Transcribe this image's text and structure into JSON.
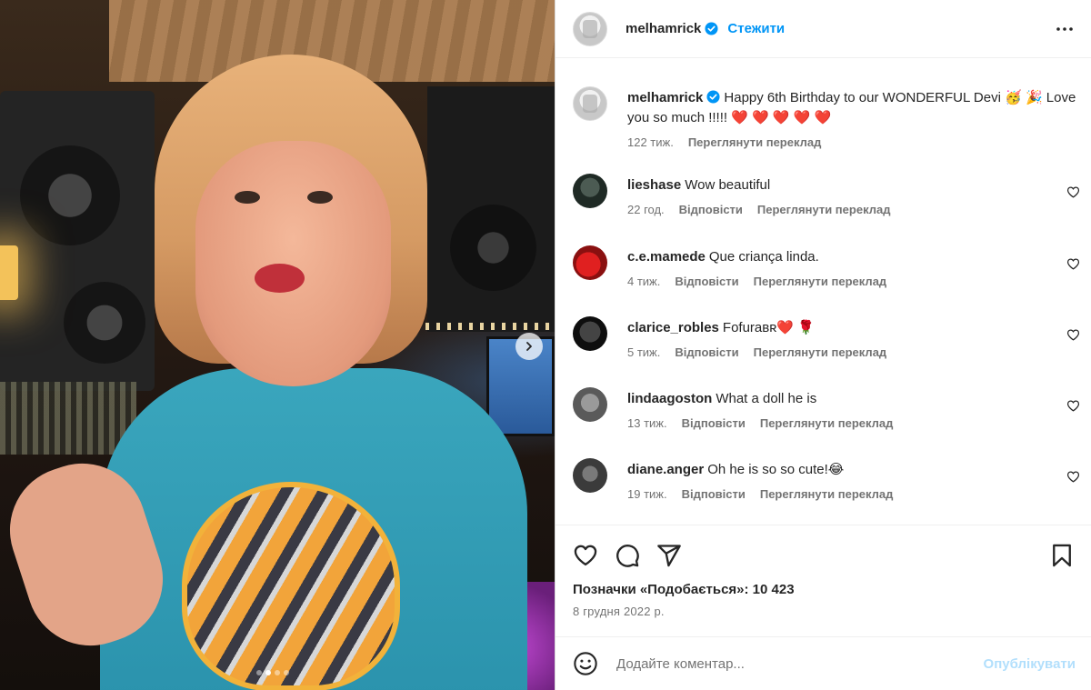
{
  "post": {
    "owner": "melhamrick",
    "follow_label": "Стежити",
    "caption": "Happy 6th Birthday to our WONDERFUL Devi 🥳 🎉 Love you so much !!!!! ❤️ ❤️ ❤️ ❤️ ❤️",
    "caption_time": "122 тиж.",
    "see_translation": "Переглянути переклад",
    "likes_label": "Позначки «Подобається»: 10 423",
    "date": "8 грудня 2022 р.",
    "carousel": {
      "current_slide": 2,
      "total_slides": 4
    }
  },
  "comments": [
    {
      "user": "lieshase",
      "text": "Wow beautiful",
      "time": "22 год.",
      "reply": "Відповісти",
      "translate": "Переглянути переклад"
    },
    {
      "user": "c.e.mamede",
      "text": "Que criança linda.",
      "time": "4 тиж.",
      "reply": "Відповісти",
      "translate": "Переглянути переклад"
    },
    {
      "user": "clarice_robles",
      "text": "Fofuraʙʀ❤️ 🌹",
      "time": "5 тиж.",
      "reply": "Відповісти",
      "translate": "Переглянути переклад"
    },
    {
      "user": "lindaagoston",
      "text": "What a doll he is",
      "time": "13 тиж.",
      "reply": "Відповісти",
      "translate": "Переглянути переклад"
    },
    {
      "user": "diane.anger",
      "text": "Oh he is so so cute!😂",
      "time": "19 тиж.",
      "reply": "Відповісти",
      "translate": "Переглянути переклад"
    }
  ],
  "composer": {
    "placeholder": "Додайте коментар...",
    "publish_label": "Опублікувати"
  },
  "icons": {
    "verified": "verified-badge-icon",
    "more": "more-options-icon",
    "like": "heart-icon",
    "comment": "comment-icon",
    "share": "share-icon",
    "save": "bookmark-icon",
    "emoji": "emoji-icon",
    "next": "chevron-right-icon"
  },
  "colors": {
    "accent": "#0095f6",
    "verified": "#0095f6",
    "publish_disabled": "#b2dffc",
    "secondary_text": "#737373"
  }
}
